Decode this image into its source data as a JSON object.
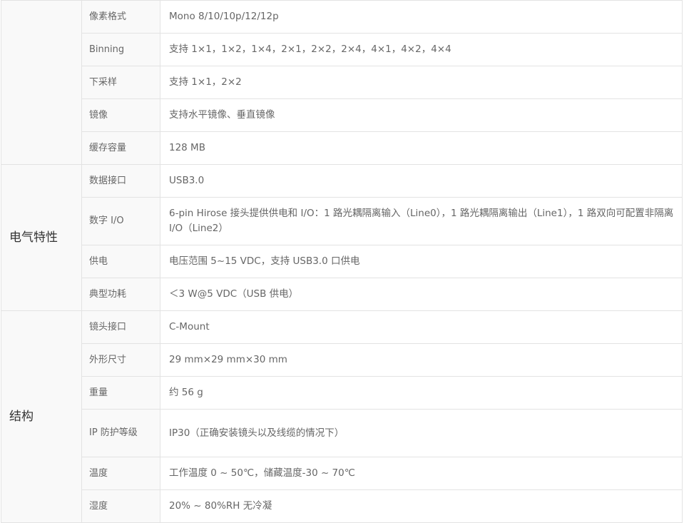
{
  "groups": {
    "electrical": "电气特性",
    "structure": "结构"
  },
  "rows": [
    {
      "label": "像素格式",
      "value": "Mono 8/10/10p/12/12p"
    },
    {
      "label": "Binning",
      "value": "支持 1×1，1×2，1×4，2×1，2×2，2×4，4×1，4×2，4×4"
    },
    {
      "label": "下采样",
      "value": "支持 1×1，2×2"
    },
    {
      "label": "镜像",
      "value": "支持水平镜像、垂直镜像"
    },
    {
      "label": "缓存容量",
      "value": "128 MB"
    },
    {
      "label": "数据接口",
      "value": "USB3.0"
    },
    {
      "label": "数字 I/O",
      "value": "6-pin Hirose 接头提供供电和 I/O：1 路光耦隔离输入（Line0），1 路光耦隔离输出（Line1），1 路双向可配置非隔离 I/O（Line2）"
    },
    {
      "label": "供电",
      "value": "电压范围 5~15 VDC，支持 USB3.0 口供电"
    },
    {
      "label": "典型功耗",
      "value": "＜3 W@5 VDC（USB 供电）"
    },
    {
      "label": "镜头接口",
      "value": "C-Mount"
    },
    {
      "label": "外形尺寸",
      "value": "29 mm×29 mm×30 mm"
    },
    {
      "label": "重量",
      "value": "约 56 g"
    },
    {
      "label": "IP 防护等级",
      "value": "IP30（正确安装镜头以及线缆的情况下）"
    },
    {
      "label": "温度",
      "value": "工作温度 0 ~ 50℃，储藏温度-30 ~ 70℃"
    },
    {
      "label": "湿度",
      "value": "20% ~ 80%RH 无冷凝"
    }
  ]
}
